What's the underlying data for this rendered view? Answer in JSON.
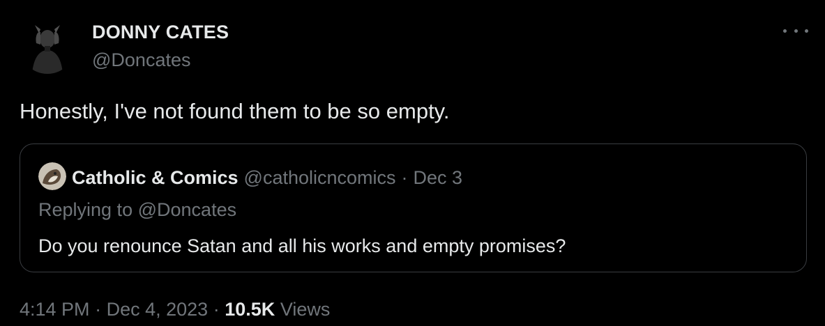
{
  "author": {
    "display_name": "DONNY CATES",
    "handle": "@Doncates",
    "avatar_icon": "profile-photo-icon"
  },
  "menu": {
    "more_icon": "more-options-icon"
  },
  "tweet": {
    "text": "Honestly, I've not found them to be so empty."
  },
  "quoted": {
    "display_name": "Catholic & Comics",
    "handle": "@catholicncomics",
    "separator": "·",
    "date": "Dec 3",
    "replying_prefix": "Replying to",
    "replying_to": "@Doncates",
    "text": "Do you renounce Satan and all his works and empty promises?"
  },
  "meta": {
    "time": "4:14 PM",
    "separator": "·",
    "date": "Dec 4, 2023",
    "views_count": "10.5K",
    "views_label": "Views"
  },
  "colors": {
    "background": "#000000",
    "primary_text": "#e7e9ea",
    "secondary_text": "#71767b",
    "border": "#3a3d41"
  }
}
